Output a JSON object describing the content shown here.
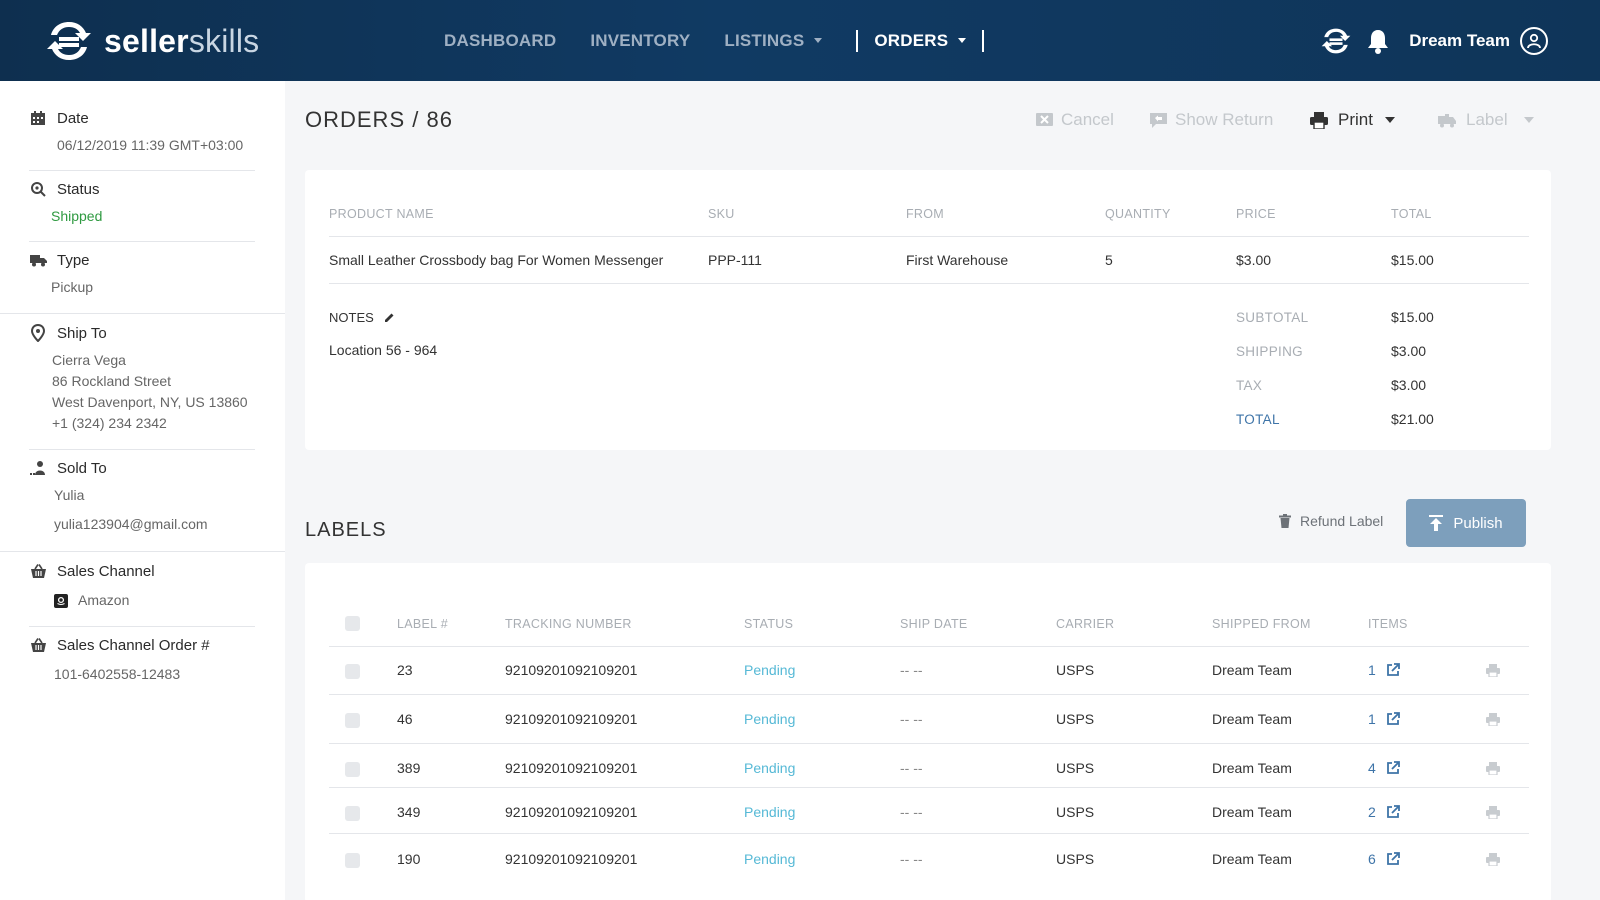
{
  "app": {
    "brand_bold": "seller",
    "brand_light": "skills"
  },
  "nav": {
    "items": [
      {
        "label": "DASHBOARD",
        "active": false,
        "dropdown": false
      },
      {
        "label": "INVENTORY",
        "active": false,
        "dropdown": false
      },
      {
        "label": "LISTINGS",
        "active": false,
        "dropdown": true
      },
      {
        "label": "ORDERS",
        "active": true,
        "dropdown": true
      }
    ],
    "user": "Dream Team",
    "icons": [
      "sync-logo-icon",
      "bell-icon",
      "user-circle-icon"
    ]
  },
  "sidebar": {
    "date": {
      "label": "Date",
      "value": "06/12/2019 11:39 GMT+03:00",
      "icon": "calendar-icon"
    },
    "status": {
      "label": "Status",
      "value": "Shipped",
      "icon": "status-search-icon"
    },
    "type": {
      "label": "Type",
      "value": "Pickup",
      "icon": "truck-icon"
    },
    "ship_to": {
      "label": "Ship To",
      "icon": "map-pin-icon",
      "name": "Cierra Vega",
      "street": "86 Rockland Street",
      "city": "West Davenport, NY, US 13860",
      "phone": "+1 (324) 234 2342"
    },
    "sold_to": {
      "label": "Sold To",
      "icon": "person-icon",
      "name": "Yulia",
      "email": "yulia123904@gmail.com"
    },
    "sales_channel": {
      "label": "Sales Channel",
      "icon": "basket-icon",
      "value": "Amazon",
      "value_icon": "amazon-icon"
    },
    "sales_channel_order": {
      "label": "Sales Channel Order #",
      "icon": "basket-icon",
      "value": "101-6402558-12483"
    }
  },
  "order": {
    "title": "ORDERS / 86",
    "actions": {
      "cancel": "Cancel",
      "show_return": "Show Return",
      "print": "Print",
      "label": "Label"
    },
    "table": {
      "headers": [
        "PRODUCT NAME",
        "SKU",
        "FROM",
        "QUANTITY",
        "PRICE",
        "TOTAL"
      ],
      "row": [
        "Small Leather Crossbody bag For Women Messenger",
        "PPP-111",
        "First Warehouse",
        "5",
        "$3.00",
        "$15.00"
      ]
    },
    "notes": {
      "label": "NOTES",
      "text": "Location 56 - 964"
    },
    "summary": {
      "subtotal_label": "SUBTOTAL",
      "subtotal": "$15.00",
      "shipping_label": "SHIPPING",
      "shipping": "$3.00",
      "tax_label": "TAX",
      "tax": "$3.00",
      "total_label": "TOTAL",
      "total": "$21.00"
    }
  },
  "labels": {
    "title": "LABELS",
    "refund": "Refund Label",
    "publish": "Publish",
    "headers": [
      "LABEL #",
      "TRACKING NUMBER",
      "STATUS",
      "SHIP DATE",
      "CARRIER",
      "SHIPPED FROM",
      "ITEMS"
    ],
    "rows": [
      {
        "label": "23",
        "tracking": "92109201092109201",
        "status": "Pending",
        "ship_date": "-- --",
        "carrier": "USPS",
        "from": "Dream Team",
        "items": "1"
      },
      {
        "label": "46",
        "tracking": "92109201092109201",
        "status": "Pending",
        "ship_date": "-- --",
        "carrier": "USPS",
        "from": "Dream Team",
        "items": "1"
      },
      {
        "label": "389",
        "tracking": "92109201092109201",
        "status": "Pending",
        "ship_date": "-- --",
        "carrier": "USPS",
        "from": "Dream Team",
        "items": "4"
      },
      {
        "label": "349",
        "tracking": "92109201092109201",
        "status": "Pending",
        "ship_date": "-- --",
        "carrier": "USPS",
        "from": "Dream Team",
        "items": "2"
      },
      {
        "label": "190",
        "tracking": "92109201092109201",
        "status": "Pending",
        "ship_date": "-- --",
        "carrier": "USPS",
        "from": "Dream Team",
        "items": "6"
      }
    ]
  },
  "colors": {
    "header": "#0f3559",
    "accent": "#3e74a8",
    "pending": "#56b9d6",
    "shipped": "#2f9a41",
    "publish": "#7d9fbc"
  }
}
